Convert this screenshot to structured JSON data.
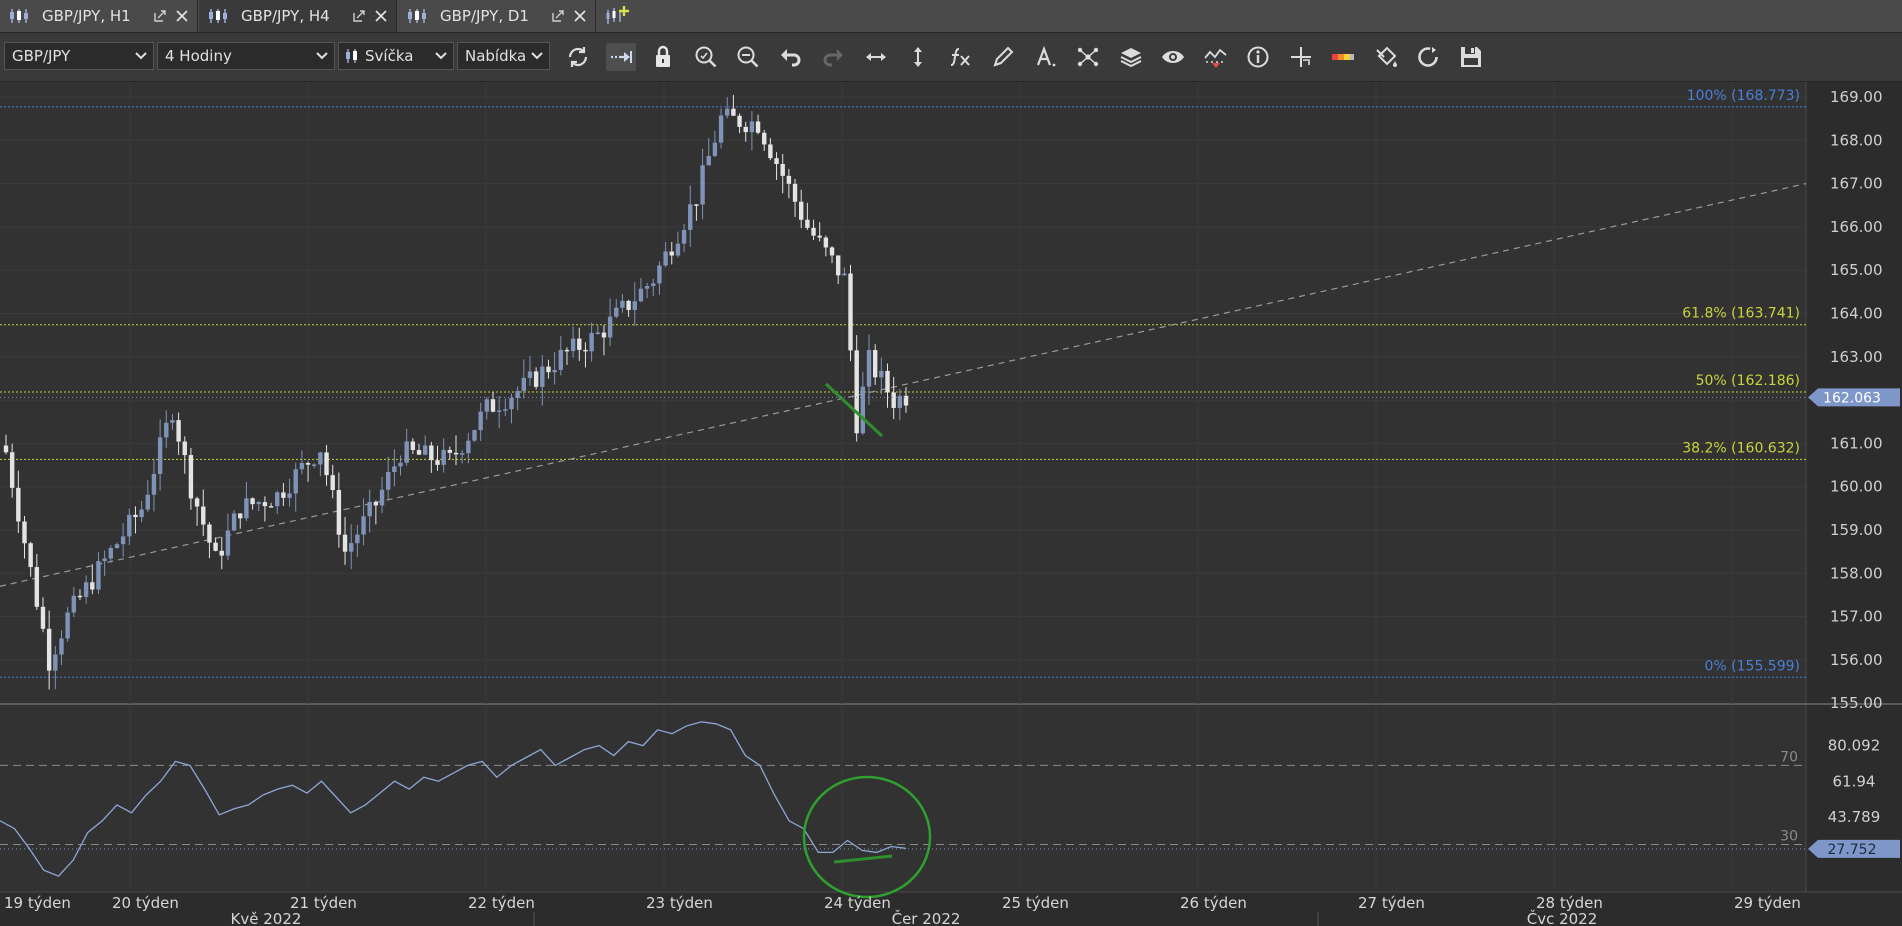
{
  "tabs": [
    {
      "label": "GBP/JPY, H1",
      "active": false
    },
    {
      "label": "GBP/JPY, H4",
      "active": true
    },
    {
      "label": "GBP/JPY, D1",
      "active": false
    }
  ],
  "toolbar": {
    "symbol": "GBP/JPY",
    "timeframe": "4 Hodiny",
    "chart_type": "Svíčka",
    "price_type": "Nabídka",
    "icons": [
      "refresh-icon",
      "auto-scroll-icon",
      "lock-icon",
      "zoom-in-icon",
      "zoom-out-icon",
      "undo-icon",
      "redo-icon",
      "horizontal-resize-icon",
      "vertical-resize-icon",
      "indicators-fx-icon",
      "pencil-icon",
      "text-tool-icon",
      "objects-icon",
      "layers-icon",
      "visibility-icon",
      "alerts-icon",
      "info-icon",
      "crosshair-icon",
      "colors-icon",
      "paint-bucket-icon",
      "sync-icon",
      "save-icon"
    ]
  },
  "chart_data": [
    {
      "type": "candlestick",
      "symbol": "GBP/JPY",
      "timeframe": "H4",
      "y_ticks": [
        "169.00",
        "168.00",
        "167.00",
        "166.00",
        "165.00",
        "164.00",
        "163.00",
        "162.00",
        "161.00",
        "160.00",
        "159.00",
        "158.00",
        "157.00",
        "156.00",
        "155.00"
      ],
      "ylim": [
        155.0,
        169.3
      ],
      "current_price": "162.063",
      "fib_levels": [
        {
          "label": "100% (168.773)",
          "value": 168.773,
          "color": "#4a7fd6"
        },
        {
          "label": "61.8% (163.741)",
          "value": 163.741,
          "color": "#c9d43a"
        },
        {
          "label": "50% (162.186)",
          "value": 162.186,
          "color": "#c9d43a"
        },
        {
          "label": "38.2% (160.632)",
          "value": 160.632,
          "color": "#c9d43a"
        },
        {
          "label": "0% (155.599)",
          "value": 155.599,
          "color": "#4a7fd6"
        }
      ],
      "trendline": {
        "from": [
          0,
          157.7
        ],
        "to": [
          1,
          167.0
        ]
      },
      "candle_count": 125,
      "path": [
        [
          0,
          160.8
        ],
        [
          7,
          156.0
        ],
        [
          10,
          157.0
        ],
        [
          17,
          158.5
        ],
        [
          22,
          159.5
        ],
        [
          27,
          161.8
        ],
        [
          30,
          160.0
        ],
        [
          34,
          158.3
        ],
        [
          38,
          159.5
        ],
        [
          44,
          159.8
        ],
        [
          51,
          160.9
        ],
        [
          55,
          158.5
        ],
        [
          60,
          159.6
        ],
        [
          64,
          160.8
        ],
        [
          72,
          160.6
        ],
        [
          78,
          161.8
        ],
        [
          84,
          162.3
        ],
        [
          90,
          163.0
        ],
        [
          96,
          163.5
        ],
        [
          105,
          164.8
        ],
        [
          112,
          166.7
        ],
        [
          116,
          168.5
        ],
        [
          122,
          168.4
        ],
        [
          130,
          166.0
        ],
        [
          136,
          164.8
        ],
        [
          138,
          161.5
        ],
        [
          140,
          162.9
        ],
        [
          144,
          162.0
        ],
        [
          146,
          162.1
        ]
      ]
    },
    {
      "type": "line",
      "name": "oscillator",
      "y_ticks": [
        "80.092",
        "61.94",
        "43.789"
      ],
      "current_value": "27.752",
      "levels": [
        {
          "label": "70",
          "value": 70
        },
        {
          "label": "30",
          "value": 30
        }
      ],
      "ylim": [
        8,
        98
      ],
      "values": [
        42,
        38,
        28,
        17,
        14,
        22,
        36,
        42,
        50,
        46,
        55,
        62,
        72,
        70,
        58,
        45,
        48,
        50,
        55,
        58,
        60,
        56,
        62,
        54,
        46,
        50,
        56,
        62,
        58,
        64,
        62,
        66,
        70,
        72,
        64,
        70,
        74,
        78,
        70,
        74,
        78,
        80,
        75,
        82,
        80,
        88,
        86,
        90,
        92,
        91,
        88,
        75,
        70,
        55,
        42,
        38,
        26,
        26,
        32,
        27,
        26,
        29,
        28
      ]
    },
    {
      "type": "time-axis",
      "week_labels": [
        "19 týden",
        "20 týden",
        "21 týden",
        "22 týden",
        "23 týden",
        "24 týden",
        "25 týden",
        "26 týden",
        "27 týden",
        "28 týden",
        "29 týden"
      ],
      "month_labels": [
        "Kvě 2022",
        "Čer 2022",
        "Čvc 2022"
      ]
    }
  ],
  "colors": {
    "background": "#303030",
    "candle_up": "#7f93b8",
    "candle_down": "#e4e4e4",
    "price_tag": "#7e97c8",
    "annotation": "#2f8f2f"
  }
}
